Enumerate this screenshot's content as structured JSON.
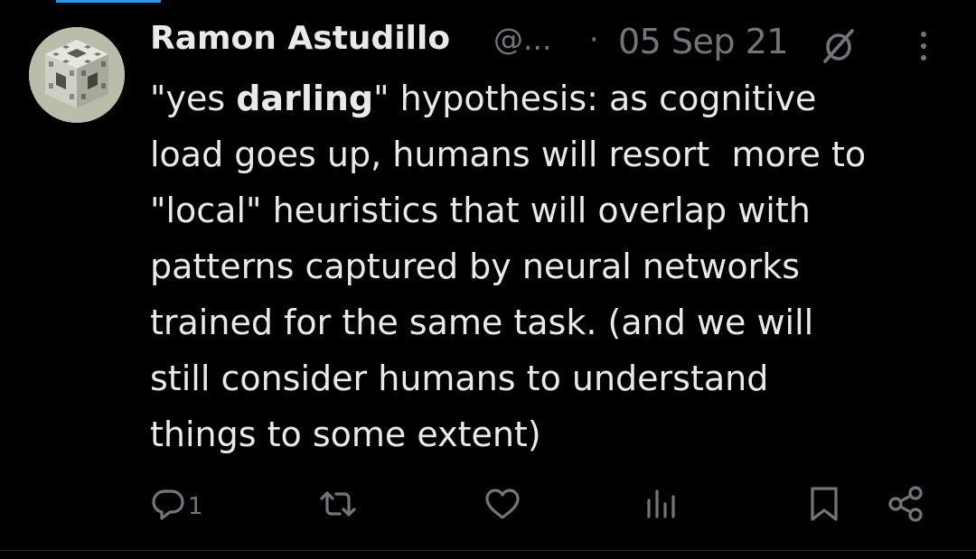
{
  "tweet": {
    "author": {
      "display_name": "Ramon Astudillo",
      "handle": "@...",
      "avatar_icon": "menger-sponge-avatar"
    },
    "separator": "·",
    "date": "05 Sep 21",
    "status_icon": "muted-icon",
    "menu_icon": "more-vertical-icon",
    "text_lines": [
      {
        "segments": [
          {
            "text": "\"yes ",
            "bold": false
          },
          {
            "text": "darling",
            "bold": true
          },
          {
            "text": "\" hypothesis: as cognitive",
            "bold": false
          }
        ]
      },
      {
        "segments": [
          {
            "text": "load goes up, humans will resort  more to",
            "bold": false
          }
        ]
      },
      {
        "segments": [
          {
            "text": "\"local\" heuristics that will overlap with",
            "bold": false
          }
        ]
      },
      {
        "segments": [
          {
            "text": "patterns captured by neural networks",
            "bold": false
          }
        ]
      },
      {
        "segments": [
          {
            "text": "trained for the same task. (and we will",
            "bold": false
          }
        ]
      },
      {
        "segments": [
          {
            "text": "still consider humans to understand",
            "bold": false
          }
        ]
      },
      {
        "segments": [
          {
            "text": "things to some extent)",
            "bold": false
          }
        ]
      }
    ],
    "actions": {
      "reply": {
        "icon": "reply-icon",
        "count": "1"
      },
      "retweet": {
        "icon": "retweet-icon"
      },
      "like": {
        "icon": "heart-icon"
      },
      "views": {
        "icon": "views-icon"
      },
      "bookmark": {
        "icon": "bookmark-icon"
      },
      "share": {
        "icon": "share-icon"
      }
    }
  },
  "colors": {
    "background": "#000000",
    "text": "#e7e9ea",
    "muted": "#71767b",
    "accent": "#1d9bf0",
    "divider": "#2f3336"
  }
}
